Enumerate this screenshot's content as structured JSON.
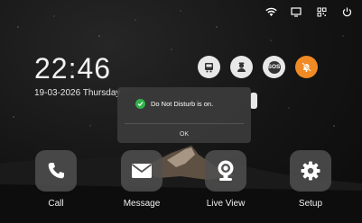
{
  "clock": {
    "time": "22:46",
    "date": "19-03-2026 Thursday"
  },
  "status_icons": [
    "wifi-icon",
    "monitor-icon",
    "network-icon",
    "power-icon"
  ],
  "quick_actions": [
    {
      "icon": "elevator-icon",
      "color": "#e8e8e8"
    },
    {
      "icon": "security-guard-icon",
      "color": "#e8e8e8"
    },
    {
      "icon": "sos-icon",
      "label": "SOS",
      "color": "#e8e8e8"
    },
    {
      "icon": "bell-mute-icon",
      "color": "#f08a24"
    }
  ],
  "toast": {
    "message": "Do Not Disturb is on.",
    "ok_label": "OK",
    "check_color": "#2fb34a"
  },
  "apps": [
    {
      "label": "Call",
      "icon": "phone-icon"
    },
    {
      "label": "Message",
      "icon": "envelope-icon"
    },
    {
      "label": "Live View",
      "icon": "camera-icon"
    },
    {
      "label": "Setup",
      "icon": "gear-icon"
    }
  ]
}
